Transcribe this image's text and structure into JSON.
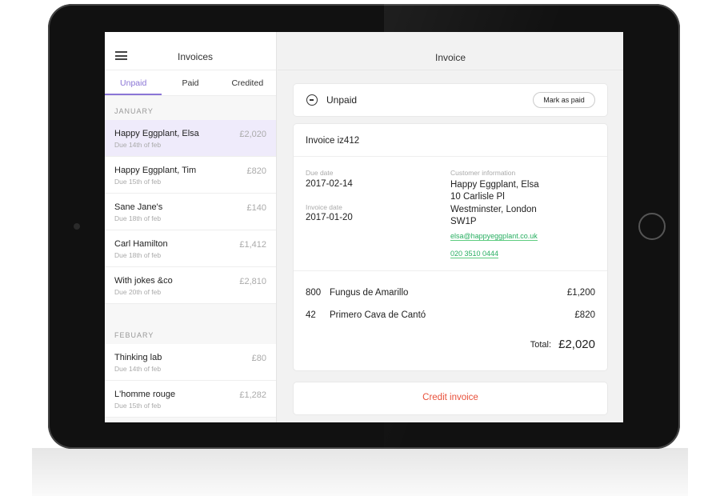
{
  "sidebar": {
    "title": "Invoices",
    "tabs": [
      {
        "label": "Unpaid",
        "active": true
      },
      {
        "label": "Paid"
      },
      {
        "label": "Credited"
      }
    ],
    "sections": [
      {
        "label": "JANUARY",
        "items": [
          {
            "name": "Happy Eggplant, Elsa",
            "due": "Due 14th of feb",
            "amount": "£2,020",
            "selected": true
          },
          {
            "name": "Happy Eggplant, Tim",
            "due": "Due 15th of feb",
            "amount": "£820"
          },
          {
            "name": "Sane Jane's",
            "due": "Due 18th of feb",
            "amount": "£140"
          },
          {
            "name": "Carl Hamilton",
            "due": "Due 18th of feb",
            "amount": "£1,412"
          },
          {
            "name": "With jokes &co",
            "due": "Due 20th of feb",
            "amount": "£2,810"
          }
        ]
      },
      {
        "label": "FEBUARY",
        "items": [
          {
            "name": "Thinking lab",
            "due": "Due 14th of feb",
            "amount": "£80"
          },
          {
            "name": "L'homme rouge",
            "due": "Due 15th of feb",
            "amount": "£1,282"
          }
        ]
      }
    ]
  },
  "main": {
    "title": "Invoice",
    "status": "Unpaid",
    "mark_paid": "Mark as paid",
    "invoice_title": "Invoice iz412",
    "due_label": "Due date",
    "due_date": "2017-02-14",
    "invoice_date_label": "Invoice date",
    "invoice_date": "2017-01-20",
    "customer_label": "Customer information",
    "customer": [
      "Happy Eggplant, Elsa",
      "10 Carlisle Pl",
      "Westminster, London",
      "SW1P"
    ],
    "email": "elsa@happyeggplant.co.uk",
    "phone": "020 3510 0444",
    "lines": [
      {
        "qty": "800",
        "desc": "Fungus de Amarillo",
        "amount": "£1,200"
      },
      {
        "qty": "42",
        "desc": "Primero Cava de Cantó",
        "amount": "£820"
      }
    ],
    "total_label": "Total:",
    "total": "£2,020",
    "credit": "Credit invoice"
  },
  "colors": {
    "accent": "#8a75d6",
    "link": "#27ae60",
    "danger": "#e8503a",
    "selected_row": "#efebfb"
  }
}
